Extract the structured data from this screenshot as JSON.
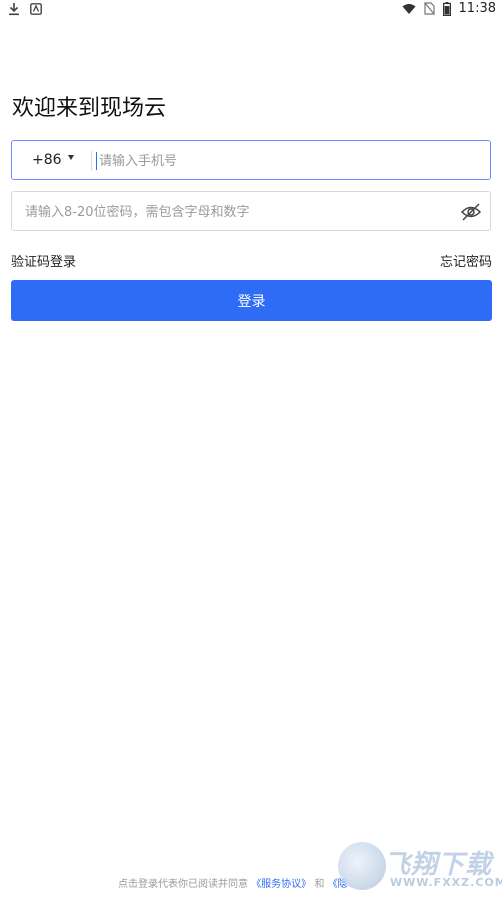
{
  "status_bar": {
    "time": "11:38",
    "left_icons": [
      "download-icon",
      "notification-icon"
    ],
    "right_icons": [
      "wifi-icon",
      "no-sim-icon",
      "battery-icon"
    ]
  },
  "title": "欢迎来到现场云",
  "phone": {
    "country_code": "+86",
    "placeholder": "请输入手机号",
    "value": ""
  },
  "password": {
    "placeholder": "请输入8-20位密码，需包含字母和数字",
    "value": "",
    "toggle_icon": "eye-off-icon"
  },
  "links": {
    "sms_login": "验证码登录",
    "forgot_password": "忘记密码"
  },
  "login_button": "登录",
  "footer": {
    "prefix": "点击登录代表你已阅读并同意",
    "service_agreement": "《服务协议》",
    "and": "和",
    "privacy_partial": "《隐"
  },
  "watermark": {
    "main": "飞翔下载",
    "sub": "WWW.FXXZ.COM"
  },
  "colors": {
    "accent": "#2f6cf6",
    "focus_border": "#6a8cff",
    "placeholder": "#9a9a9a"
  }
}
